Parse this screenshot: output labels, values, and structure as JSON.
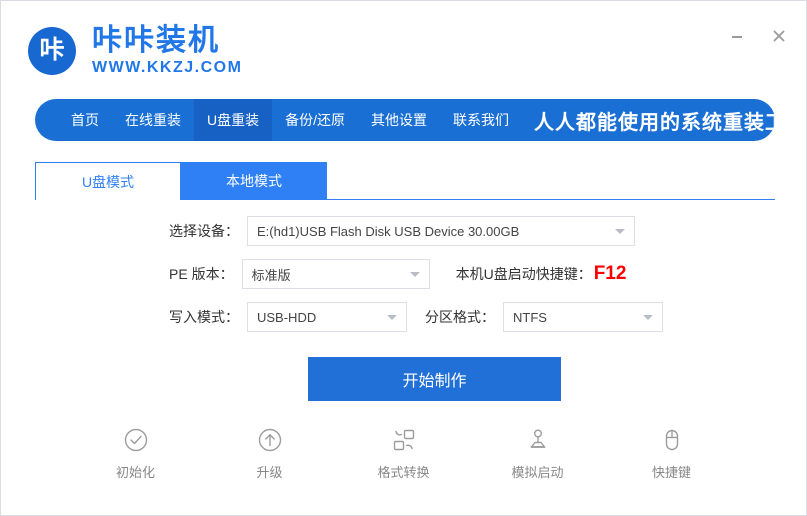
{
  "window": {
    "minimize_label": "—",
    "close_label": "×"
  },
  "brand": {
    "logo_glyph": "咔",
    "name": "咔咔装机",
    "url": "WWW.KKZJ.COM",
    "accent_color": "#2277e8"
  },
  "nav": {
    "items": [
      {
        "label": "首页",
        "active": false
      },
      {
        "label": "在线重装",
        "active": false
      },
      {
        "label": "U盘重装",
        "active": true
      },
      {
        "label": "备份/还原",
        "active": false
      },
      {
        "label": "其他设置",
        "active": false
      },
      {
        "label": "联系我们",
        "active": false
      }
    ],
    "tagline": "人人都能使用的系统重装工具",
    "bar_color": "#1a6fd4",
    "active_color": "#1761c4"
  },
  "tabs": [
    {
      "label": "U盘模式",
      "active": true
    },
    {
      "label": "本地模式",
      "active": false
    }
  ],
  "form": {
    "device": {
      "label": "选择设备：",
      "value": "E:(hd1)USB Flash Disk USB Device 30.00GB"
    },
    "pe_version": {
      "label": "PE 版本：",
      "value": "标准版"
    },
    "hotkey": {
      "label": "本机U盘启动快捷键：",
      "key": "F12",
      "key_color": "#ff0000"
    },
    "write_mode": {
      "label": "写入模式：",
      "value": "USB-HDD"
    },
    "partition_format": {
      "label": "分区格式：",
      "value": "NTFS"
    }
  },
  "primary_action": {
    "label": "开始制作",
    "color": "#2170d8"
  },
  "tools": [
    {
      "label": "初始化",
      "icon": "check-circle-icon"
    },
    {
      "label": "升级",
      "icon": "arrow-up-circle-icon"
    },
    {
      "label": "格式转换",
      "icon": "format-convert-icon"
    },
    {
      "label": "模拟启动",
      "icon": "joystick-icon"
    },
    {
      "label": "快捷键",
      "icon": "mouse-icon"
    }
  ]
}
